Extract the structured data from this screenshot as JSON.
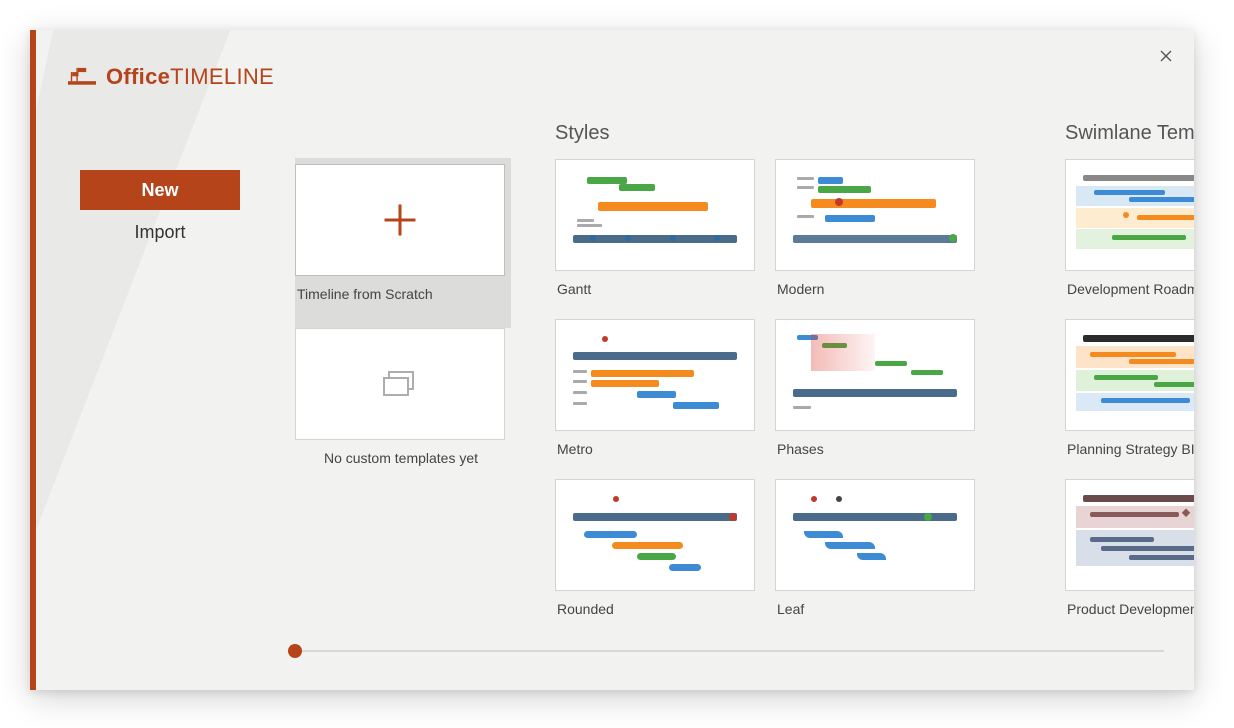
{
  "brand": {
    "prefix": "Office",
    "suffix": "TIMELINE"
  },
  "sidebar": {
    "new": "New",
    "import": "Import"
  },
  "sections": {
    "scratch_card": "Timeline from Scratch",
    "empty_card": "No custom templates yet",
    "styles_title": "Styles",
    "styles": {
      "gantt": "Gantt",
      "modern": "Modern",
      "metro": "Metro",
      "phases": "Phases",
      "rounded": "Rounded",
      "leaf": "Leaf"
    },
    "swimlane_title": "Swimlane Temp",
    "swimlane": {
      "dev": "Development Roadmap",
      "plan": "Planning Strategy BI Ro",
      "prod": "Product Development &"
    }
  }
}
